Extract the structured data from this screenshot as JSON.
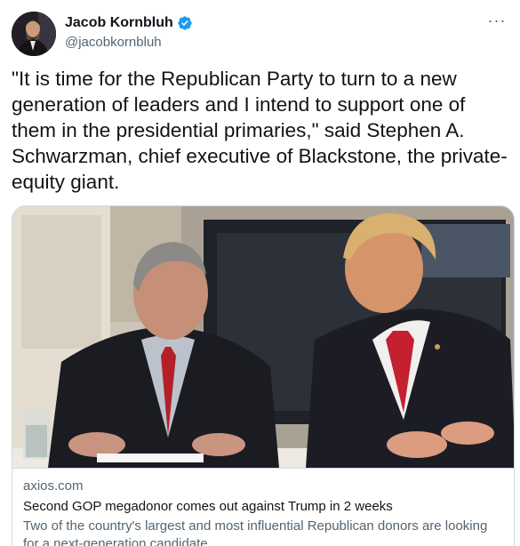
{
  "author": {
    "display_name": "Jacob Kornbluh",
    "handle": "@jacobkornbluh",
    "verified": true,
    "avatar_icon": "profile-photo"
  },
  "menu": {
    "more_label": "···"
  },
  "tweet": {
    "text": "\"It is time for the Republican Party to turn to a new generation of leaders and I intend to support one of them in the presidential primaries,\" said Stephen A. Schwarzman, chief executive of Blackstone, the private-equity giant."
  },
  "card": {
    "domain": "axios.com",
    "title": "Second GOP megadonor comes out against Trump in 2 weeks",
    "description": "Two of the country's largest and most influential Republican donors are looking for a next-generation candidate."
  },
  "colors": {
    "verified_blue": "#1d9bf0",
    "secondary_text": "#536471",
    "border": "#cfd9de"
  }
}
